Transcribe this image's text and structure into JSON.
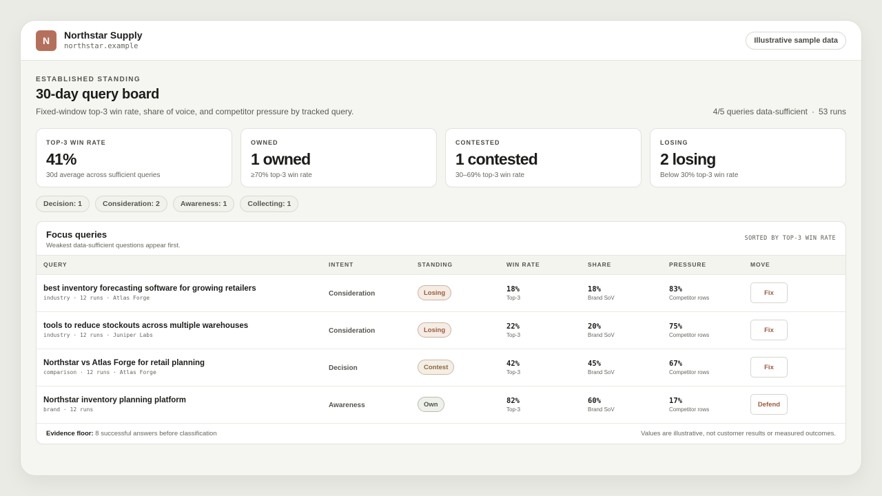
{
  "header": {
    "logo_letter": "N",
    "brand_name": "Northstar Supply",
    "brand_domain": "northstar.example",
    "sample_label": "Illustrative sample data"
  },
  "page": {
    "eyebrow": "ESTABLISHED STANDING",
    "title": "30-day query board",
    "subtitle": "Fixed-window top-3 win rate, share of voice, and competitor pressure by tracked query.",
    "summary_sufficient": "4/5 queries data-sufficient",
    "summary_separator": "·",
    "summary_runs": "53 runs"
  },
  "cards": [
    {
      "label": "TOP-3 WIN RATE",
      "value": "41%",
      "note": "30d average across sufficient queries"
    },
    {
      "label": "OWNED",
      "value": "1 owned",
      "note": "≥70% top-3 win rate"
    },
    {
      "label": "CONTESTED",
      "value": "1 contested",
      "note": "30–69% top-3 win rate"
    },
    {
      "label": "LOSING",
      "value": "2 losing",
      "note": "Below 30% top-3 win rate"
    }
  ],
  "chips": [
    {
      "label": "Decision: 1"
    },
    {
      "label": "Consideration: 2"
    },
    {
      "label": "Awareness: 1"
    },
    {
      "label": "Collecting: 1"
    }
  ],
  "panel": {
    "title": "Focus queries",
    "subtitle": "Weakest data-sufficient questions appear first.",
    "sort_note": "SORTED BY TOP-3 WIN RATE",
    "columns": {
      "query": "QUERY",
      "intent": "INTENT",
      "standing": "STANDING",
      "win_rate": "WIN RATE",
      "share": "SHARE",
      "pressure": "PRESSURE",
      "move": "MOVE"
    },
    "rows": [
      {
        "query": "best inventory forecasting software for growing retailers",
        "meta": "industry · 12 runs · Atlas Forge",
        "intent": "Consideration",
        "standing": "Losing",
        "win_rate": "18%",
        "win_sub": "Top-3",
        "share": "18%",
        "share_sub": "Brand SoV",
        "pressure": "83%",
        "pressure_sub": "Competitor rows",
        "move": "Fix"
      },
      {
        "query": "tools to reduce stockouts across multiple warehouses",
        "meta": "industry · 12 runs · Juniper Labs",
        "intent": "Consideration",
        "standing": "Losing",
        "win_rate": "22%",
        "win_sub": "Top-3",
        "share": "20%",
        "share_sub": "Brand SoV",
        "pressure": "75%",
        "pressure_sub": "Competitor rows",
        "move": "Fix"
      },
      {
        "query": "Northstar vs Atlas Forge for retail planning",
        "meta": "comparison · 12 runs · Atlas Forge",
        "intent": "Decision",
        "standing": "Contest",
        "win_rate": "42%",
        "win_sub": "Top-3",
        "share": "45%",
        "share_sub": "Brand SoV",
        "pressure": "67%",
        "pressure_sub": "Competitor rows",
        "move": "Fix"
      },
      {
        "query": "Northstar inventory planning platform",
        "meta": "brand · 12 runs",
        "intent": "Awareness",
        "standing": "Own",
        "win_rate": "82%",
        "win_sub": "Top-3",
        "share": "60%",
        "share_sub": "Brand SoV",
        "pressure": "17%",
        "pressure_sub": "Competitor rows",
        "move": "Defend"
      }
    ],
    "footer_label": "Evidence floor:",
    "footer_text": "8 successful answers before classification",
    "footer_disclaimer": "Values are illustrative, not customer results or measured outcomes."
  }
}
